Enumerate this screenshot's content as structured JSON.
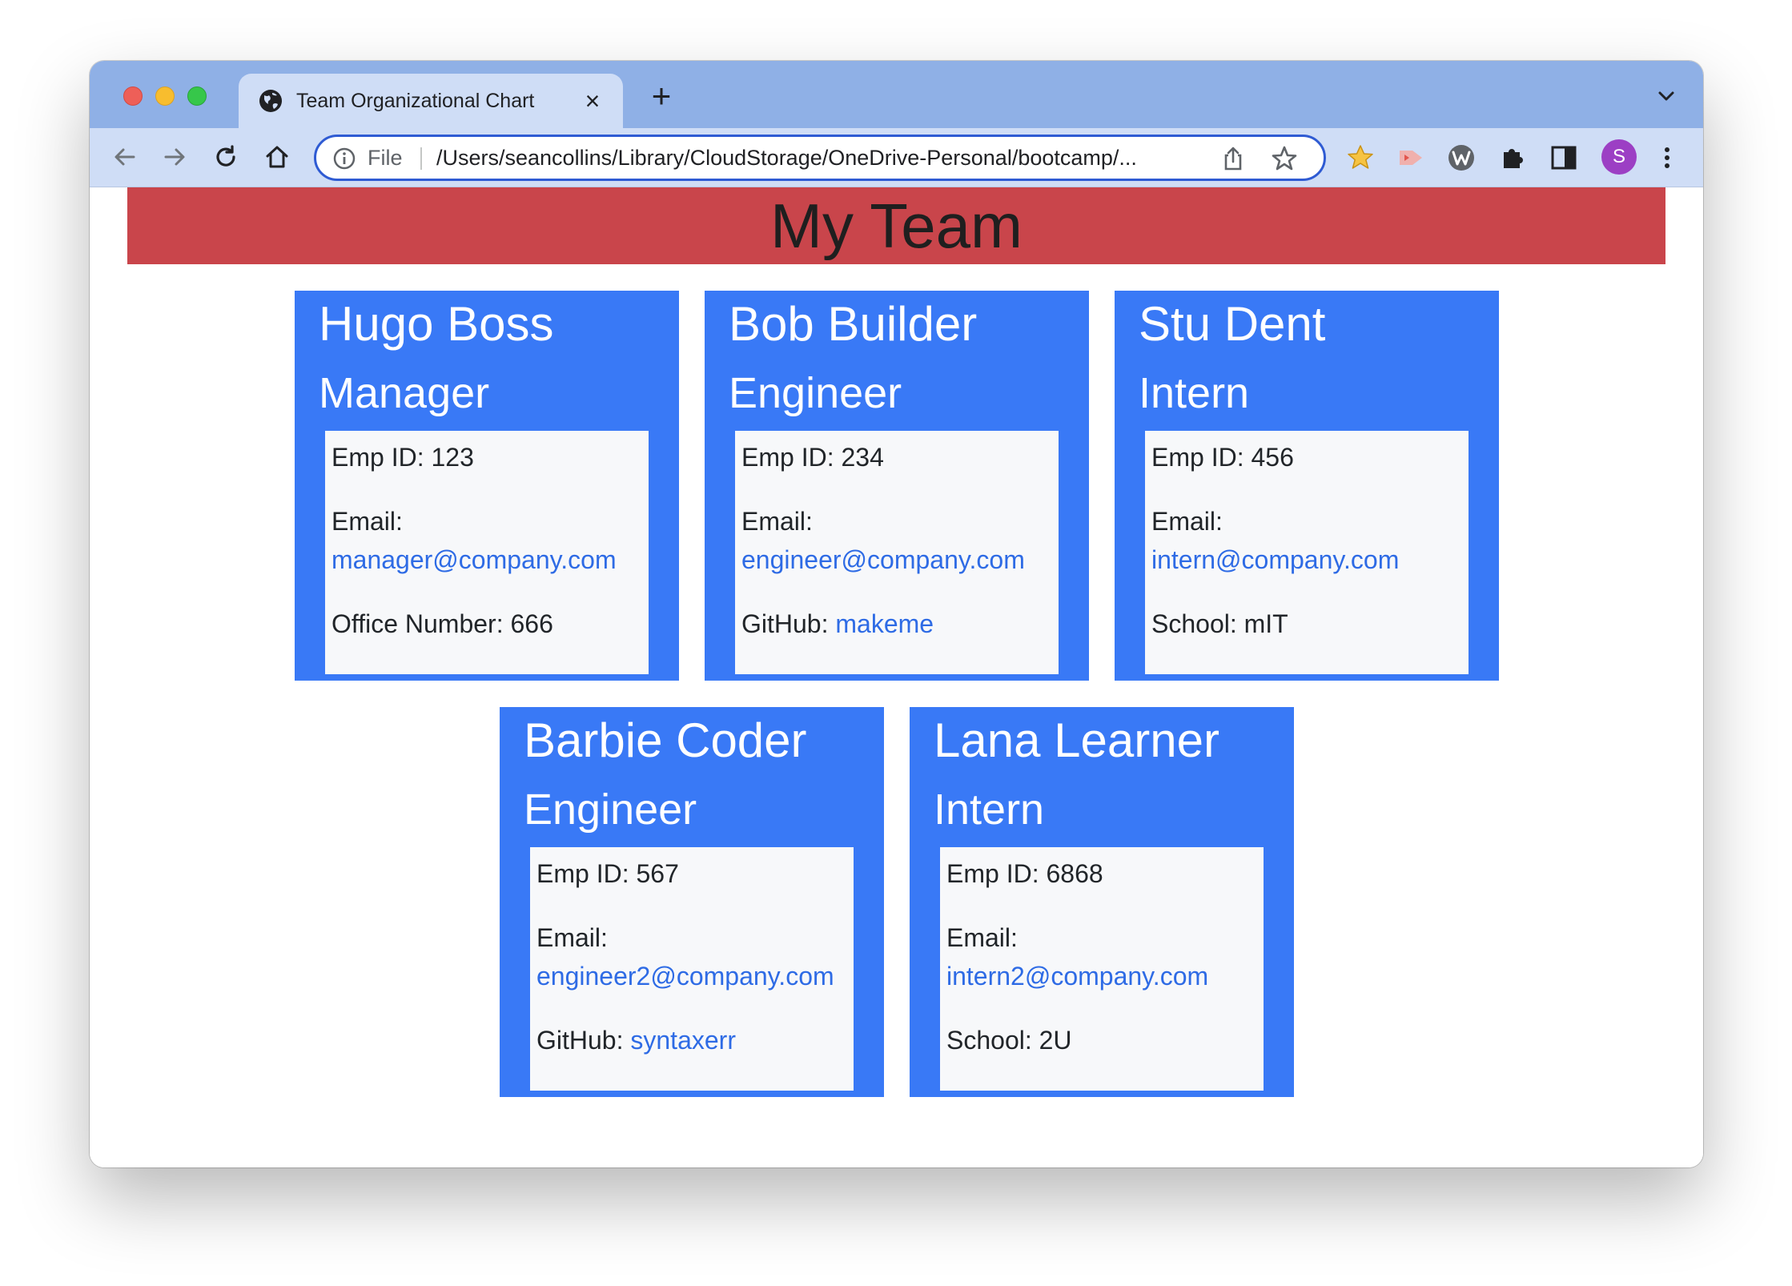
{
  "browser": {
    "tab_title": "Team Organizational Chart",
    "tab_close": "×",
    "new_tab": "+",
    "omnibox_prefix": "File",
    "url": "/Users/seancollins/Library/CloudStorage/OneDrive-Personal/bootcamp/...",
    "profile_initial": "S",
    "icons": [
      "back-arrow-icon",
      "forward-arrow-icon",
      "reload-icon",
      "home-icon",
      "info-icon",
      "share-icon",
      "bookmark-star-icon",
      "favorites-star-icon",
      "cast-icon",
      "w-extension-icon",
      "puzzle-icon",
      "side-panel-icon",
      "kebab-menu-icon"
    ]
  },
  "page": {
    "heading": "My Team",
    "colors": {
      "banner": "#c9454b",
      "card": "#3979f6",
      "card_body": "#f7f8fa",
      "link": "#2e6be5"
    }
  },
  "employees": [
    {
      "name": "Hugo Boss",
      "role": "Manager",
      "id_label": "Emp ID: 123",
      "email_label": "Email:",
      "email": "manager@company.com",
      "extra_label": "Office Number: 666",
      "extra_link": ""
    },
    {
      "name": "Bob Builder",
      "role": "Engineer",
      "id_label": "Emp ID: 234",
      "email_label": "Email:",
      "email": "engineer@company.com",
      "extra_label": "GitHub: ",
      "extra_link": "makeme"
    },
    {
      "name": "Stu Dent",
      "role": "Intern",
      "id_label": "Emp ID: 456",
      "email_label": "Email:",
      "email": "intern@company.com",
      "extra_label": "School: mIT",
      "extra_link": ""
    },
    {
      "name": "Barbie Coder",
      "role": "Engineer",
      "id_label": "Emp ID: 567",
      "email_label": "Email:",
      "email": "engineer2@company.com",
      "extra_label": "GitHub: ",
      "extra_link": "syntaxerr"
    },
    {
      "name": "Lana Learner",
      "role": "Intern",
      "id_label": "Emp ID: 6868",
      "email_label": "Email:",
      "email": "intern2@company.com",
      "extra_label": "School: 2U",
      "extra_link": ""
    }
  ]
}
